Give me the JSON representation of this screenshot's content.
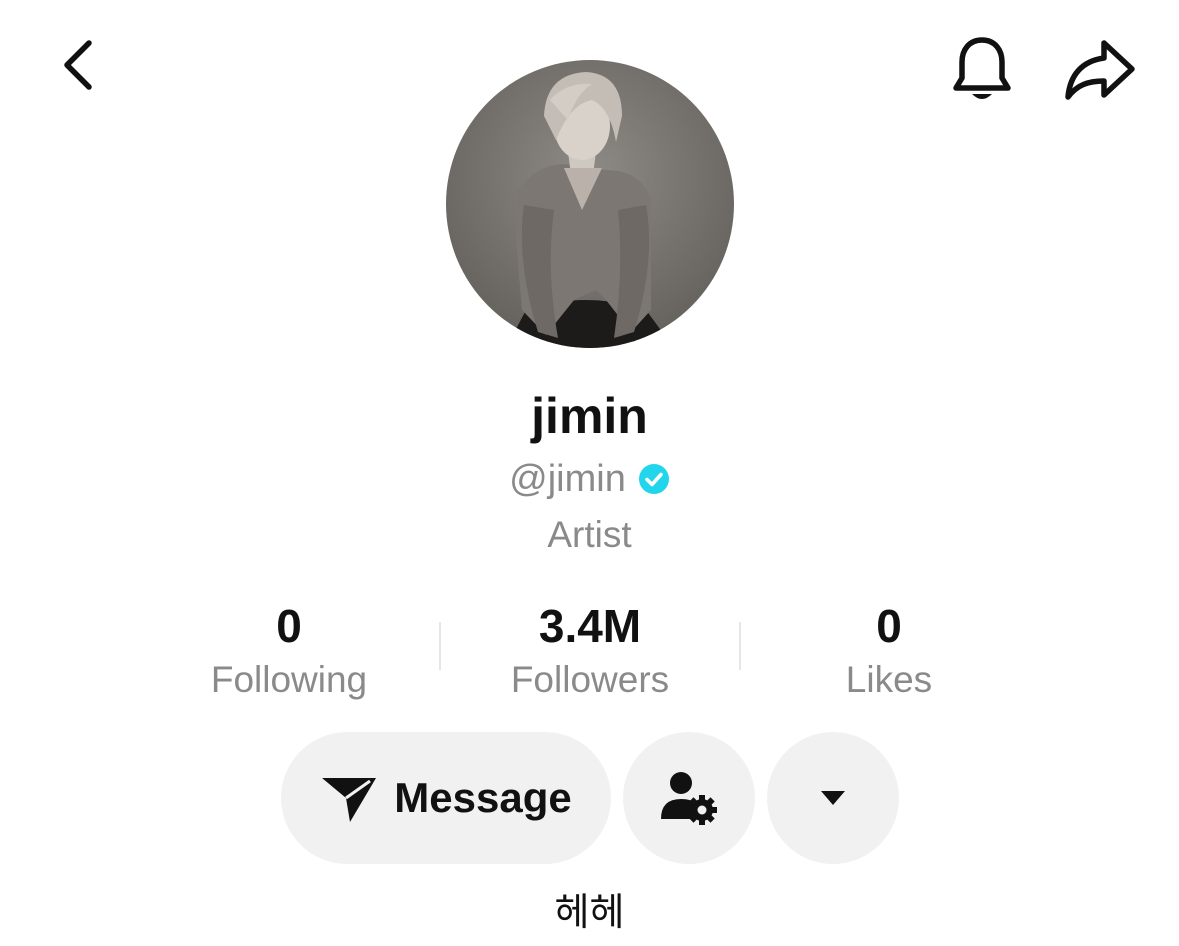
{
  "header": {
    "back_icon": "chevron-left-icon",
    "notification_icon": "bell-icon",
    "share_icon": "share-arrow-icon"
  },
  "profile": {
    "display_name": "jimin",
    "handle": "@jimin",
    "verified": true,
    "verified_color": "#20D5EC",
    "category": "Artist",
    "bio": "헤헤"
  },
  "stats": [
    {
      "value": "0",
      "label": "Following"
    },
    {
      "value": "3.4M",
      "label": "Followers"
    },
    {
      "value": "0",
      "label": "Likes"
    }
  ],
  "actions": {
    "message_label": "Message",
    "message_icon": "send-icon",
    "friend_icon": "user-settings-icon",
    "more_icon": "caret-down-icon"
  }
}
